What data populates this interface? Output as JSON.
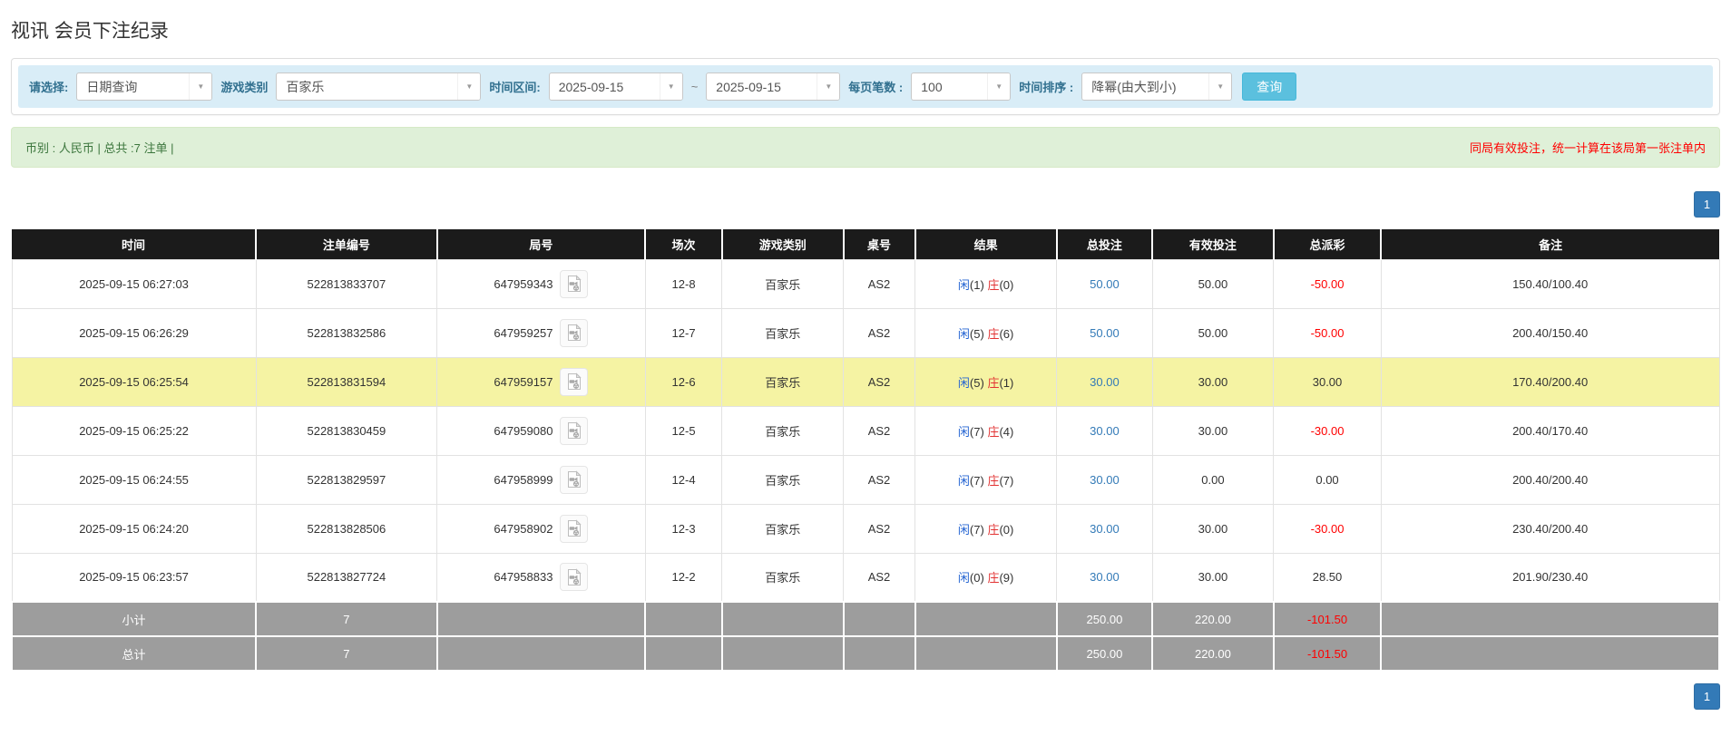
{
  "page": {
    "title": "视讯 会员下注纪录"
  },
  "filters": {
    "select_type": {
      "label": "请选择:",
      "value": "日期查询"
    },
    "game_type": {
      "label": "游戏类别",
      "value": "百家乐"
    },
    "time_range": {
      "label": "时间区间:",
      "from": "2025-09-15",
      "tilde": "~",
      "to": "2025-09-15"
    },
    "page_size": {
      "label": "每页笔数 :",
      "value": "100"
    },
    "sort_order": {
      "label": "时间排序 :",
      "value": "降幂(由大到小)"
    },
    "query_button": "查询"
  },
  "summary": {
    "left": "币别 : 人民币 | 总共 :7 注单 |",
    "note": "同局有效投注，统一计算在该局第一张注单内"
  },
  "pagination": {
    "page": "1"
  },
  "table": {
    "headers": [
      "时间",
      "注单编号",
      "局号",
      "场次",
      "游戏类别",
      "桌号",
      "结果",
      "总投注",
      "有效投注",
      "总派彩",
      "备注"
    ],
    "rows": [
      {
        "time": "2025-09-15 06:27:03",
        "bet_id": "522813833707",
        "round_id": "647959343",
        "session": "12-8",
        "game": "百家乐",
        "table_no": "AS2",
        "result": {
          "player_label": "闲",
          "player": "(1)",
          "banker_label": "庄",
          "banker": "(0)"
        },
        "total_bet": "50.00",
        "valid_bet": "50.00",
        "payout": "-50.00",
        "remark": "150.40/100.40",
        "highlight": false
      },
      {
        "time": "2025-09-15 06:26:29",
        "bet_id": "522813832586",
        "round_id": "647959257",
        "session": "12-7",
        "game": "百家乐",
        "table_no": "AS2",
        "result": {
          "player_label": "闲",
          "player": "(5)",
          "banker_label": "庄",
          "banker": "(6)"
        },
        "total_bet": "50.00",
        "valid_bet": "50.00",
        "payout": "-50.00",
        "remark": "200.40/150.40",
        "highlight": false
      },
      {
        "time": "2025-09-15 06:25:54",
        "bet_id": "522813831594",
        "round_id": "647959157",
        "session": "12-6",
        "game": "百家乐",
        "table_no": "AS2",
        "result": {
          "player_label": "闲",
          "player": "(5)",
          "banker_label": "庄",
          "banker": "(1)"
        },
        "total_bet": "30.00",
        "valid_bet": "30.00",
        "payout": "30.00",
        "remark": "170.40/200.40",
        "highlight": true
      },
      {
        "time": "2025-09-15 06:25:22",
        "bet_id": "522813830459",
        "round_id": "647959080",
        "session": "12-5",
        "game": "百家乐",
        "table_no": "AS2",
        "result": {
          "player_label": "闲",
          "player": "(7)",
          "banker_label": "庄",
          "banker": "(4)"
        },
        "total_bet": "30.00",
        "valid_bet": "30.00",
        "payout": "-30.00",
        "remark": "200.40/170.40",
        "highlight": false
      },
      {
        "time": "2025-09-15 06:24:55",
        "bet_id": "522813829597",
        "round_id": "647958999",
        "session": "12-4",
        "game": "百家乐",
        "table_no": "AS2",
        "result": {
          "player_label": "闲",
          "player": "(7)",
          "banker_label": "庄",
          "banker": "(7)"
        },
        "total_bet": "30.00",
        "valid_bet": "0.00",
        "payout": "0.00",
        "remark": "200.40/200.40",
        "highlight": false
      },
      {
        "time": "2025-09-15 06:24:20",
        "bet_id": "522813828506",
        "round_id": "647958902",
        "session": "12-3",
        "game": "百家乐",
        "table_no": "AS2",
        "result": {
          "player_label": "闲",
          "player": "(7)",
          "banker_label": "庄",
          "banker": "(0)"
        },
        "total_bet": "30.00",
        "valid_bet": "30.00",
        "payout": "-30.00",
        "remark": "230.40/200.40",
        "highlight": false
      },
      {
        "time": "2025-09-15 06:23:57",
        "bet_id": "522813827724",
        "round_id": "647958833",
        "session": "12-2",
        "game": "百家乐",
        "table_no": "AS2",
        "result": {
          "player_label": "闲",
          "player": "(0)",
          "banker_label": "庄",
          "banker": "(9)"
        },
        "total_bet": "30.00",
        "valid_bet": "30.00",
        "payout": "28.50",
        "remark": "201.90/230.40",
        "highlight": false
      }
    ],
    "footer_rows": [
      {
        "label": "小计",
        "count": "7",
        "total_bet": "250.00",
        "valid_bet": "220.00",
        "payout": "-101.50"
      },
      {
        "label": "总计",
        "count": "7",
        "total_bet": "250.00",
        "valid_bet": "220.00",
        "payout": "-101.50"
      }
    ]
  },
  "colors": {
    "filter_bar_bg": "#d9edf7",
    "filter_label": "#31708f",
    "summary_bg": "#dff0d8",
    "summary_text": "#3c763d",
    "warning_text": "#ff0000",
    "header_bg": "#1b1b1b",
    "highlight_row": "#f5f3a3",
    "footer_bg": "#9d9d9d",
    "link_blue": "#337ab7",
    "player_blue": "#2464d2",
    "banker_red": "#e23333",
    "negative_red": "#ff0000",
    "query_button": "#5bc0de",
    "page_button": "#337ab7"
  }
}
